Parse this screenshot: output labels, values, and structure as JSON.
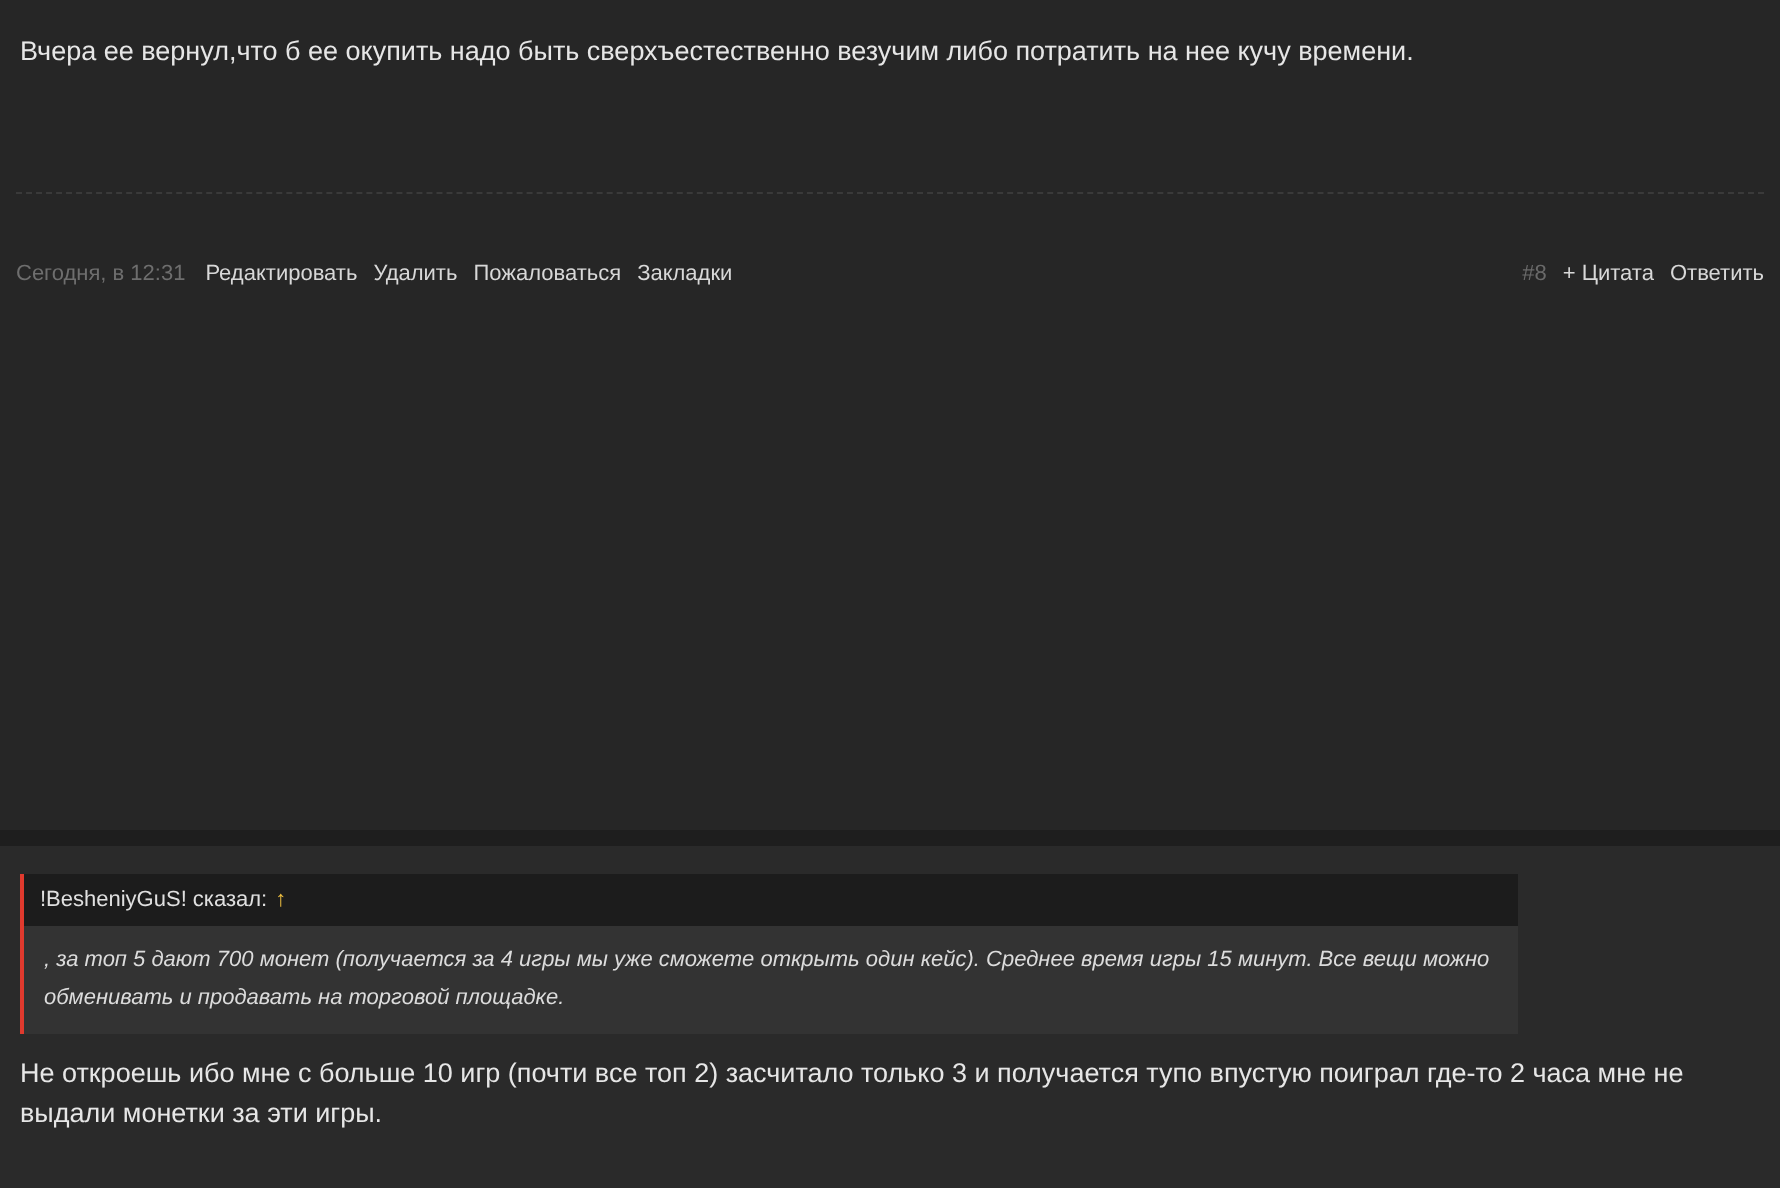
{
  "posts": [
    {
      "text": "Вчера ее вернул,что б ее окупить надо быть сверхъестественно везучим либо потратить на нее кучу времени.",
      "time": "Сегодня, в 12:31",
      "actions": [
        "Редактировать",
        "Удалить",
        "Пожаловаться",
        "Закладки"
      ],
      "number": "#8",
      "right_actions": [
        "+ Цитата",
        "Ответить"
      ]
    },
    {
      "quote": {
        "author": "!BesheniyGuS! сказал:",
        "arrow": "↑",
        "text": ", за топ 5 дают 700 монет (получается за 4 игры мы уже сможете открыть один кейс). Среднее время игры 15 минут. Все вещи можно обменивать и продавать на торговой площадке."
      },
      "text": "Не откроешь ибо мне с больше 10 игр (почти все топ 2) засчитало только 3 и получается тупо впустую поиграл где-то 2 часа мне не выдали монетки за эти игры."
    }
  ]
}
